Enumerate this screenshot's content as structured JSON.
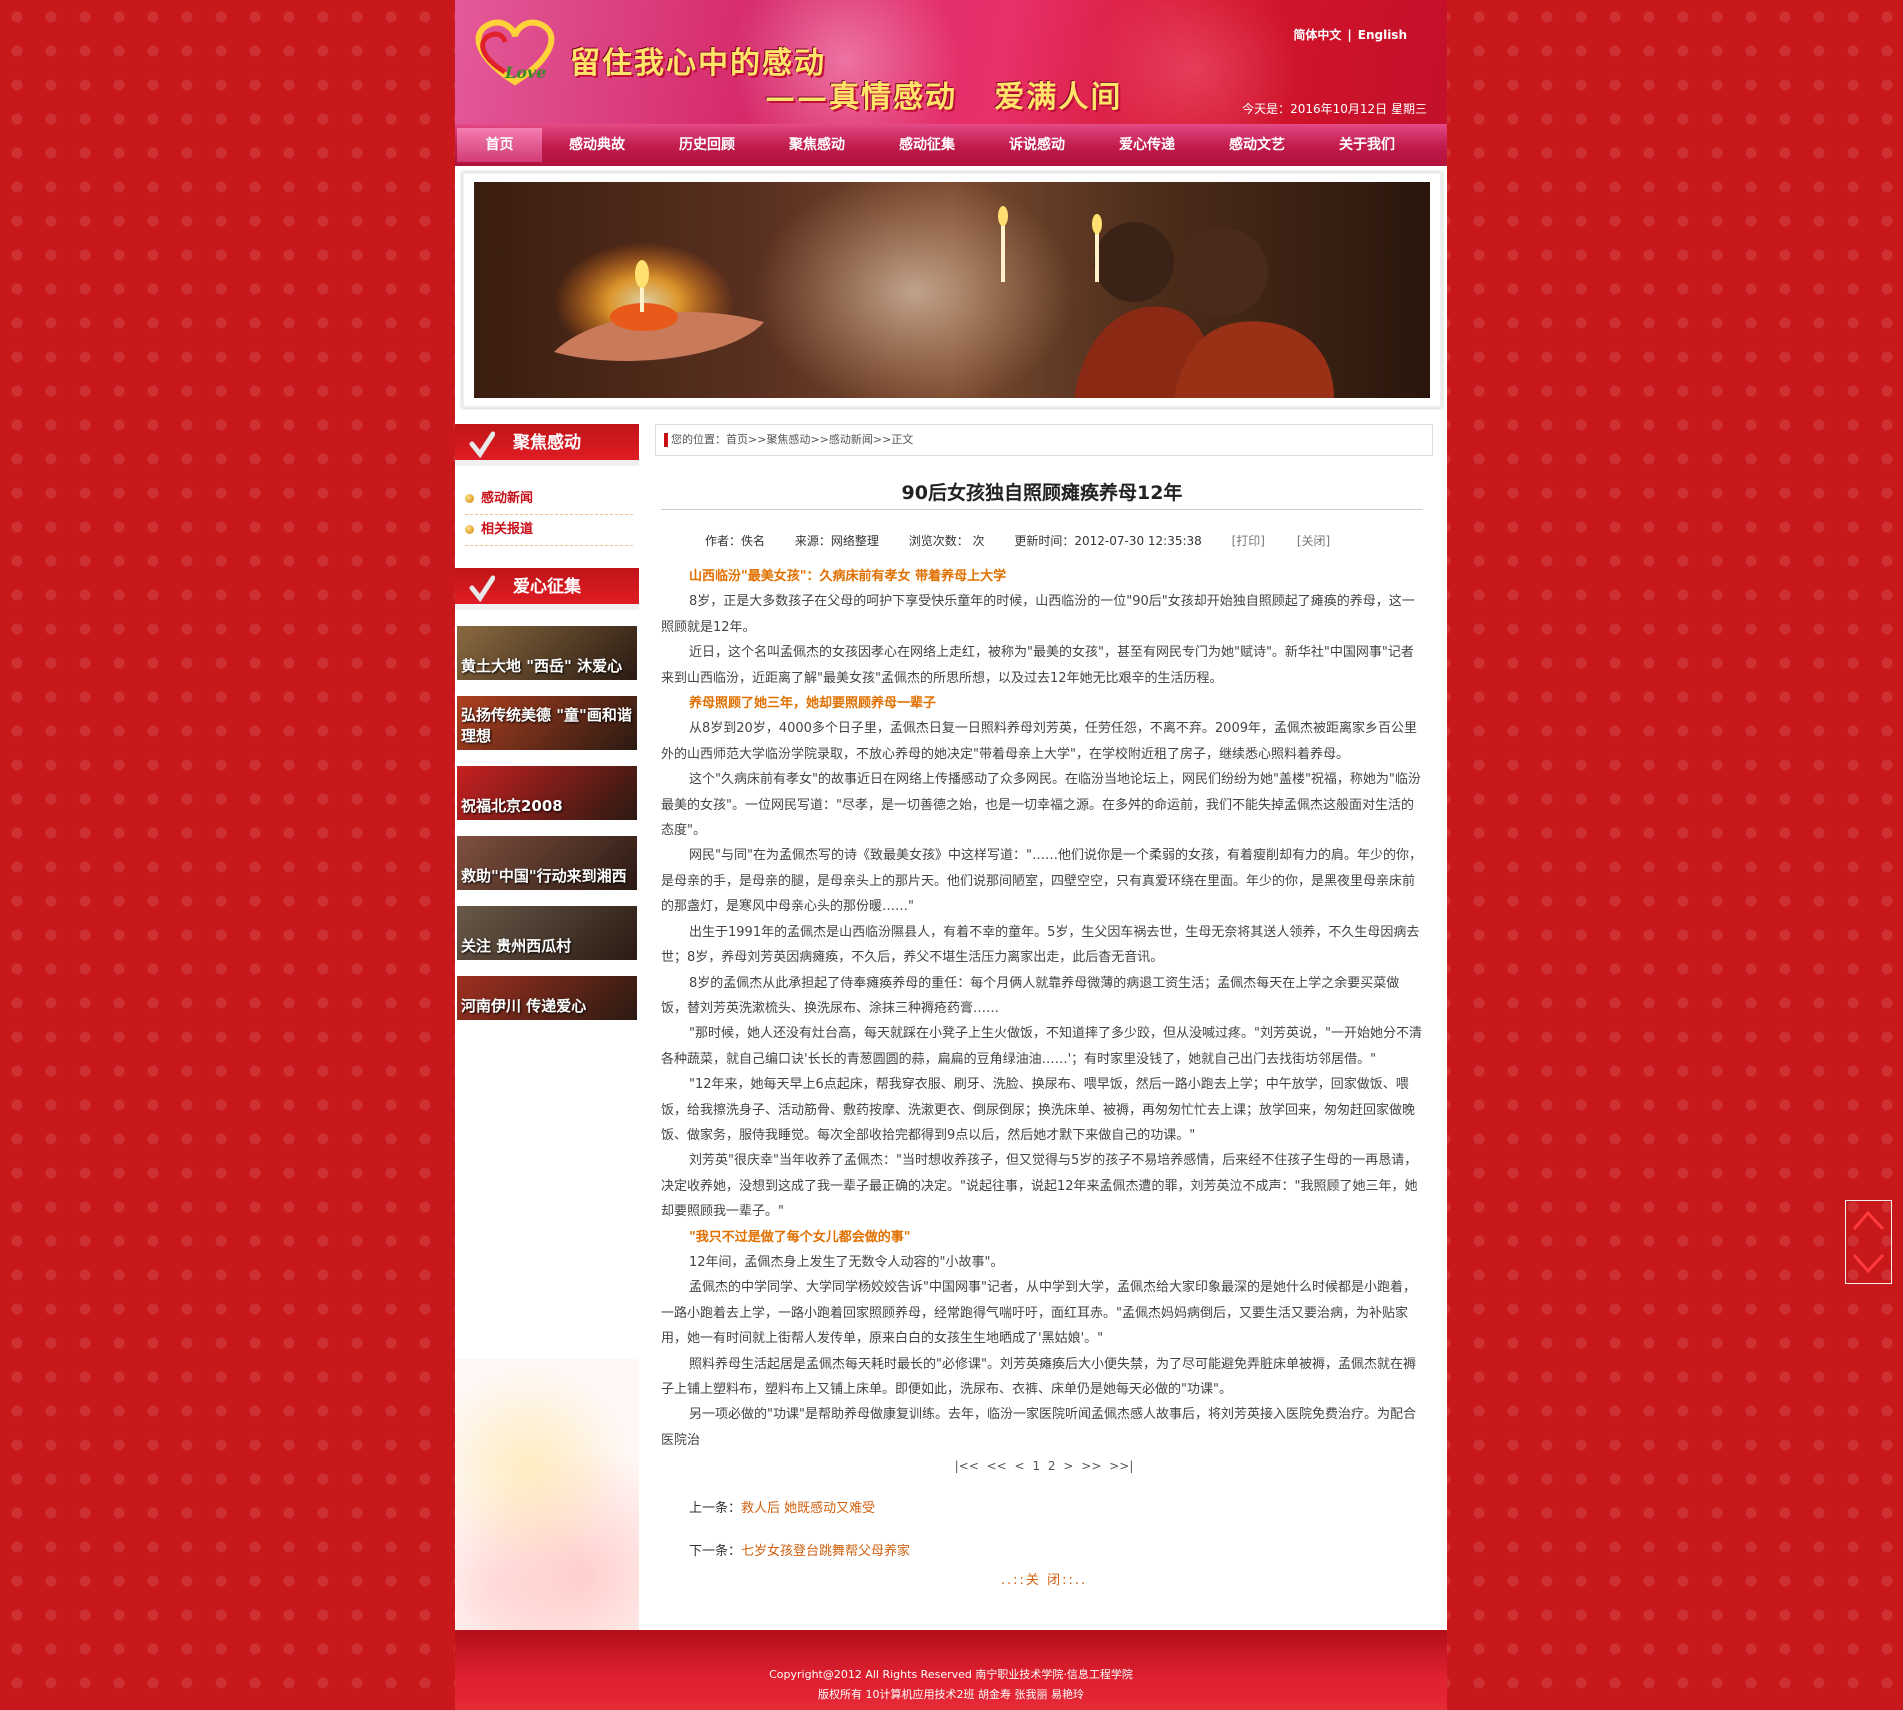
{
  "header": {
    "slogan_main": "留住我心中的感动",
    "slogan_sub": "——真情感动   爱满人间",
    "lang_cn": "简体中文",
    "lang_sep": "|",
    "lang_en": "English",
    "today": "今天是：2016年10月12日 星期三"
  },
  "nav": [
    "首页",
    "感动典故",
    "历史回顾",
    "聚焦感动",
    "感动征集",
    "诉说感动",
    "爱心传递",
    "感动文艺",
    "关于我们"
  ],
  "sidebar": {
    "section1_title": "聚焦感动",
    "section1_items": [
      "感动新闻",
      "相关报道"
    ],
    "section2_title": "爱心征集",
    "thumbs": [
      {
        "label": "黄土大地 \"西岳\" 沐爱心",
        "color": "#8a6a40"
      },
      {
        "label": "弘扬传统美德 \"童\"画和谐理想",
        "color": "#b04020"
      },
      {
        "label": "祝福北京2008",
        "color": "#c82020"
      },
      {
        "label": "救助\"中国\"行动来到湘西",
        "color": "#805040"
      },
      {
        "label": "关注 贵州西瓜村",
        "color": "#6a5a4a"
      },
      {
        "label": "河南伊川 传递爱心",
        "color": "#a03020"
      }
    ]
  },
  "crumbs": {
    "prefix": "您的位置：",
    "items": [
      "首页",
      ">>",
      "聚焦感动",
      ">>",
      "感动新闻",
      ">>",
      "正文"
    ]
  },
  "article": {
    "title": "90后女孩独自照顾瘫痪养母12年",
    "author": "作者：佚名",
    "source": "来源：网络整理",
    "views": "浏览次数：  次",
    "updated": "更新时间：2012-07-30 12:35:38",
    "print": "[打印]",
    "close": "[关闭]",
    "paragraphs": [
      {
        "h": true,
        "t": "山西临汾\"最美女孩\"：久病床前有孝女 带着养母上大学"
      },
      {
        "h": false,
        "t": "8岁，正是大多数孩子在父母的呵护下享受快乐童年的时候，山西临汾的一位\"90后\"女孩却开始独自照顾起了瘫痪的养母，这一照顾就是12年。"
      },
      {
        "h": false,
        "t": "近日，这个名叫孟佩杰的女孩因孝心在网络上走红，被称为\"最美的女孩\"，甚至有网民专门为她\"赋诗\"。新华社\"中国网事\"记者来到山西临汾，近距离了解\"最美女孩\"孟佩杰的所思所想，以及过去12年她无比艰辛的生活历程。"
      },
      {
        "h": true,
        "t": "养母照顾了她三年，她却要照顾养母一辈子"
      },
      {
        "h": false,
        "t": "从8岁到20岁，4000多个日子里，孟佩杰日复一日照料养母刘芳英，任劳任怨，不离不弃。2009年，孟佩杰被距离家乡百公里外的山西师范大学临汾学院录取，不放心养母的她决定\"带着母亲上大学\"，在学校附近租了房子，继续悉心照料着养母。"
      },
      {
        "h": false,
        "t": "这个\"久病床前有孝女\"的故事近日在网络上传播感动了众多网民。在临汾当地论坛上，网民们纷纷为她\"盖楼\"祝福，称她为\"临汾最美的女孩\"。一位网民写道：\"尽孝，是一切善德之始，也是一切幸福之源。在多舛的命运前，我们不能失掉孟佩杰这般面对生活的态度\"。"
      },
      {
        "h": false,
        "t": "网民\"与同\"在为孟佩杰写的诗《致最美女孩》中这样写道：\"……他们说你是一个柔弱的女孩，有着瘦削却有力的肩。年少的你，是母亲的手，是母亲的腿，是母亲头上的那片天。他们说那间陋室，四壁空空，只有真爱环绕在里面。年少的你，是黑夜里母亲床前的那盏灯，是寒风中母亲心头的那份暖……\""
      },
      {
        "h": false,
        "t": "出生于1991年的孟佩杰是山西临汾隰县人，有着不幸的童年。5岁，生父因车祸去世，生母无奈将其送人领养，不久生母因病去世；8岁，养母刘芳英因病瘫痪，不久后，养父不堪生活压力离家出走，此后杳无音讯。"
      },
      {
        "h": false,
        "t": "8岁的孟佩杰从此承担起了侍奉瘫痪养母的重任：每个月俩人就靠养母微薄的病退工资生活；孟佩杰每天在上学之余要买菜做饭，替刘芳英洗漱梳头、换洗尿布、涂抹三种褥疮药膏……"
      },
      {
        "h": false,
        "t": "\"那时候，她人还没有灶台高，每天就踩在小凳子上生火做饭，不知道摔了多少跤，但从没喊过疼。\"刘芳英说，\"一开始她分不清各种蔬菜，就自己编口诀'长长的青葱圆圆的蒜，扁扁的豆角绿油油……'；有时家里没钱了，她就自己出门去找街坊邻居借。\""
      },
      {
        "h": false,
        "t": "\"12年来，她每天早上6点起床，帮我穿衣服、刷牙、洗脸、换尿布、喂早饭，然后一路小跑去上学；中午放学，回家做饭、喂饭，给我擦洗身子、活动筋骨、敷药按摩、洗漱更衣、倒尿倒尿；换洗床单、被褥，再匆匆忙忙去上课；放学回来，匆匆赶回家做晚饭、做家务，服侍我睡觉。每次全部收拾完都得到9点以后，然后她才默下来做自己的功课。\""
      },
      {
        "h": false,
        "t": "刘芳英\"很庆幸\"当年收养了孟佩杰：\"当时想收养孩子，但又觉得与5岁的孩子不易培养感情，后来经不住孩子生母的一再恳请，决定收养她，没想到这成了我一辈子最正确的决定。\"说起往事，说起12年来孟佩杰遭的罪，刘芳英泣不成声：\"我照顾了她三年，她却要照顾我一辈子。\""
      },
      {
        "h": true,
        "t": "\"我只不过是做了每个女儿都会做的事\""
      },
      {
        "h": false,
        "t": "12年间，孟佩杰身上发生了无数令人动容的\"小故事\"。"
      },
      {
        "h": false,
        "t": "孟佩杰的中学同学、大学同学杨姣姣告诉\"中国网事\"记者，从中学到大学，孟佩杰给大家印象最深的是她什么时候都是小跑着，一路小跑着去上学，一路小跑着回家照顾养母，经常跑得气喘吁吁，面红耳赤。\"孟佩杰妈妈病倒后，又要生活又要治病，为补贴家用，她一有时间就上街帮人发传单，原来白白的女孩生生地晒成了'黑姑娘'。\""
      },
      {
        "h": false,
        "t": "照料养母生活起居是孟佩杰每天耗时最长的\"必修课\"。刘芳英瘫痪后大小便失禁，为了尽可能避免弄脏床单被褥，孟佩杰就在褥子上铺上塑料布，塑料布上又铺上床单。即便如此，洗尿布、衣裤、床单仍是她每天必做的\"功课\"。"
      },
      {
        "h": false,
        "t": "另一项必做的\"功课\"是帮助养母做康复训练。去年，临汾一家医院听闻孟佩杰感人故事后，将刘芳英接入医院免费治疗。为配合医院治"
      }
    ]
  },
  "pager": [
    "|<<",
    "<<",
    "<",
    "1",
    "2",
    ">",
    ">>",
    ">>|"
  ],
  "prev_label": "上一条：",
  "prev_link": "救人后 她既感动又难受",
  "next_label": "下一条：",
  "next_link": "七岁女孩登台跳舞帮父母养家",
  "close_window": "..::关  闭::..",
  "footer": {
    "line1": "Copyright@2012 All Rights Reserved 南宁职业技术学院·信息工程学院",
    "line2": "版权所有 10计算机应用技术2班 胡金寿 张我丽 易艳玲"
  },
  "colors": {
    "brand_red": "#c8181c",
    "highlight": "#e07000",
    "link": "#d06010"
  }
}
